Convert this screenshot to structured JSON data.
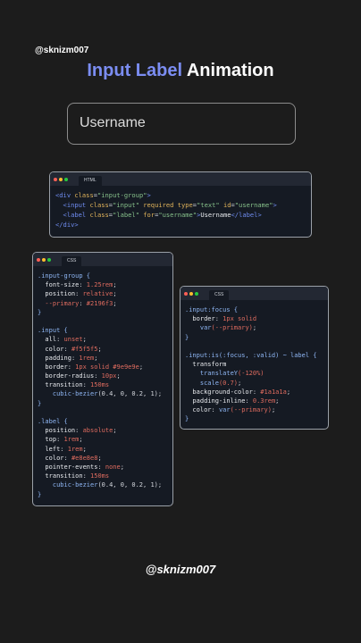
{
  "handle_top": "@sknizm007",
  "title": {
    "accent": "Input Label",
    "rest": " Animation"
  },
  "demo": {
    "label": "Username"
  },
  "colors": {
    "background": "#1c1c1c",
    "accent": "#7b8df2",
    "code_bg": "#151a23",
    "tag": "#6f8cf0",
    "attr": "#e0b35a",
    "string": "#86c08a",
    "plain": "#d4d7dd",
    "property": "#e8eaee",
    "value": "#e06c5f",
    "selector": "#8fb7f5",
    "comment": "#6a7382"
  },
  "html_card": {
    "tab": "HTML",
    "lines": [
      [
        {
          "t": "<",
          "c": "tag"
        },
        {
          "t": "div",
          "c": "tag"
        },
        {
          "t": " class",
          "c": "attr"
        },
        {
          "t": "=",
          "c": "plain"
        },
        {
          "t": "\"input-group\"",
          "c": "string"
        },
        {
          "t": ">",
          "c": "tag"
        }
      ],
      [
        {
          "t": "  <",
          "c": "tag"
        },
        {
          "t": "input",
          "c": "tag"
        },
        {
          "t": " class",
          "c": "attr"
        },
        {
          "t": "=",
          "c": "plain"
        },
        {
          "t": "\"input\"",
          "c": "string"
        },
        {
          "t": " required",
          "c": "attr"
        },
        {
          "t": " type",
          "c": "attr"
        },
        {
          "t": "=",
          "c": "plain"
        },
        {
          "t": "\"text\"",
          "c": "string"
        },
        {
          "t": " id",
          "c": "attr"
        },
        {
          "t": "=",
          "c": "plain"
        },
        {
          "t": "\"username\"",
          "c": "string"
        },
        {
          "t": ">",
          "c": "tag"
        }
      ],
      [
        {
          "t": "  <",
          "c": "tag"
        },
        {
          "t": "label",
          "c": "tag"
        },
        {
          "t": " class",
          "c": "attr"
        },
        {
          "t": "=",
          "c": "plain"
        },
        {
          "t": "\"label\"",
          "c": "string"
        },
        {
          "t": " for",
          "c": "attr"
        },
        {
          "t": "=",
          "c": "plain"
        },
        {
          "t": "\"username\"",
          "c": "string"
        },
        {
          "t": ">",
          "c": "tag"
        },
        {
          "t": "Username",
          "c": "property"
        },
        {
          "t": "</",
          "c": "tag"
        },
        {
          "t": "label",
          "c": "tag"
        },
        {
          "t": ">",
          "c": "tag"
        }
      ],
      [
        {
          "t": "</",
          "c": "tag"
        },
        {
          "t": "div",
          "c": "tag"
        },
        {
          "t": ">",
          "c": "tag"
        }
      ]
    ]
  },
  "css_card_1": {
    "tab": "CSS",
    "lines": [
      [
        {
          "t": ".input-group {",
          "c": "selector"
        }
      ],
      [
        {
          "t": "  font-size",
          "c": "property"
        },
        {
          "t": ": ",
          "c": "plain"
        },
        {
          "t": "1.25rem",
          "c": "value"
        },
        {
          "t": ";",
          "c": "plain"
        }
      ],
      [
        {
          "t": "  position",
          "c": "property"
        },
        {
          "t": ": ",
          "c": "plain"
        },
        {
          "t": "relative",
          "c": "value"
        },
        {
          "t": ";",
          "c": "plain"
        }
      ],
      [
        {
          "t": "  --primary",
          "c": "value"
        },
        {
          "t": ": ",
          "c": "plain"
        },
        {
          "t": "#2196f3",
          "c": "value"
        },
        {
          "t": ";",
          "c": "plain"
        }
      ],
      [
        {
          "t": "}",
          "c": "selector"
        }
      ],
      [],
      [
        {
          "t": ".input {",
          "c": "selector"
        }
      ],
      [
        {
          "t": "  all",
          "c": "property"
        },
        {
          "t": ": ",
          "c": "plain"
        },
        {
          "t": "unset",
          "c": "value"
        },
        {
          "t": ";",
          "c": "plain"
        }
      ],
      [
        {
          "t": "  color",
          "c": "property"
        },
        {
          "t": ": ",
          "c": "plain"
        },
        {
          "t": "#f5f5f5",
          "c": "value"
        },
        {
          "t": ";",
          "c": "plain"
        }
      ],
      [
        {
          "t": "  padding",
          "c": "property"
        },
        {
          "t": ": ",
          "c": "plain"
        },
        {
          "t": "1rem",
          "c": "value"
        },
        {
          "t": ";",
          "c": "plain"
        }
      ],
      [
        {
          "t": "  border",
          "c": "property"
        },
        {
          "t": ": ",
          "c": "plain"
        },
        {
          "t": "1px solid #9e9e9e",
          "c": "value"
        },
        {
          "t": ";",
          "c": "plain"
        }
      ],
      [
        {
          "t": "  border-radius",
          "c": "property"
        },
        {
          "t": ": ",
          "c": "plain"
        },
        {
          "t": "10px",
          "c": "value"
        },
        {
          "t": ";",
          "c": "plain"
        }
      ],
      [
        {
          "t": "  transition",
          "c": "property"
        },
        {
          "t": ": ",
          "c": "plain"
        },
        {
          "t": "150ms",
          "c": "value"
        }
      ],
      [
        {
          "t": "    cubic-bezier",
          "c": "selector"
        },
        {
          "t": "(0.4, 0, 0.2, 1)",
          "c": "plain"
        },
        {
          "t": ";",
          "c": "plain"
        }
      ],
      [
        {
          "t": "}",
          "c": "selector"
        }
      ],
      [],
      [
        {
          "t": ".label {",
          "c": "selector"
        }
      ],
      [
        {
          "t": "  position",
          "c": "property"
        },
        {
          "t": ": ",
          "c": "plain"
        },
        {
          "t": "absolute",
          "c": "value"
        },
        {
          "t": ";",
          "c": "plain"
        }
      ],
      [
        {
          "t": "  top",
          "c": "property"
        },
        {
          "t": ": ",
          "c": "plain"
        },
        {
          "t": "1rem",
          "c": "value"
        },
        {
          "t": ";",
          "c": "plain"
        }
      ],
      [
        {
          "t": "  left",
          "c": "property"
        },
        {
          "t": ": ",
          "c": "plain"
        },
        {
          "t": "1rem",
          "c": "value"
        },
        {
          "t": ";",
          "c": "plain"
        }
      ],
      [
        {
          "t": "  color",
          "c": "property"
        },
        {
          "t": ": ",
          "c": "plain"
        },
        {
          "t": "#e8e8e8",
          "c": "value"
        },
        {
          "t": ";",
          "c": "plain"
        }
      ],
      [
        {
          "t": "  pointer-events",
          "c": "property"
        },
        {
          "t": ": ",
          "c": "plain"
        },
        {
          "t": "none",
          "c": "value"
        },
        {
          "t": ";",
          "c": "plain"
        }
      ],
      [
        {
          "t": "  transition",
          "c": "property"
        },
        {
          "t": ": ",
          "c": "plain"
        },
        {
          "t": "150ms",
          "c": "value"
        }
      ],
      [
        {
          "t": "    cubic-bezier",
          "c": "selector"
        },
        {
          "t": "(0.4, 0, 0.2, 1)",
          "c": "plain"
        },
        {
          "t": ";",
          "c": "plain"
        }
      ],
      [
        {
          "t": "}",
          "c": "selector"
        }
      ]
    ]
  },
  "css_card_2": {
    "tab": "CSS",
    "lines": [
      [
        {
          "t": ".input:focus {",
          "c": "selector"
        }
      ],
      [
        {
          "t": "  border",
          "c": "property"
        },
        {
          "t": ": ",
          "c": "plain"
        },
        {
          "t": "1px solid",
          "c": "value"
        }
      ],
      [
        {
          "t": "    var",
          "c": "selector"
        },
        {
          "t": "(--primary)",
          "c": "value"
        },
        {
          "t": ";",
          "c": "plain"
        }
      ],
      [
        {
          "t": "}",
          "c": "selector"
        }
      ],
      [],
      [
        {
          "t": ".input:is(:focus, :valid) ~ label {",
          "c": "selector"
        }
      ],
      [
        {
          "t": "  transform",
          "c": "property"
        }
      ],
      [
        {
          "t": "    translateY",
          "c": "selector"
        },
        {
          "t": "(-120%)",
          "c": "value"
        }
      ],
      [
        {
          "t": "    scale",
          "c": "selector"
        },
        {
          "t": "(0.7)",
          "c": "value"
        },
        {
          "t": ";",
          "c": "plain"
        }
      ],
      [
        {
          "t": "  background-color",
          "c": "property"
        },
        {
          "t": ": ",
          "c": "plain"
        },
        {
          "t": "#1a1a1a",
          "c": "value"
        },
        {
          "t": ";",
          "c": "plain"
        }
      ],
      [
        {
          "t": "  padding-inline",
          "c": "property"
        },
        {
          "t": ": ",
          "c": "plain"
        },
        {
          "t": "0.3rem",
          "c": "value"
        },
        {
          "t": ";",
          "c": "plain"
        }
      ],
      [
        {
          "t": "  color",
          "c": "property"
        },
        {
          "t": ": ",
          "c": "plain"
        },
        {
          "t": "var",
          "c": "selector"
        },
        {
          "t": "(--primary)",
          "c": "value"
        },
        {
          "t": ";",
          "c": "plain"
        }
      ],
      [
        {
          "t": "}",
          "c": "selector"
        }
      ]
    ]
  },
  "handle_bottom": "@sknizm007"
}
